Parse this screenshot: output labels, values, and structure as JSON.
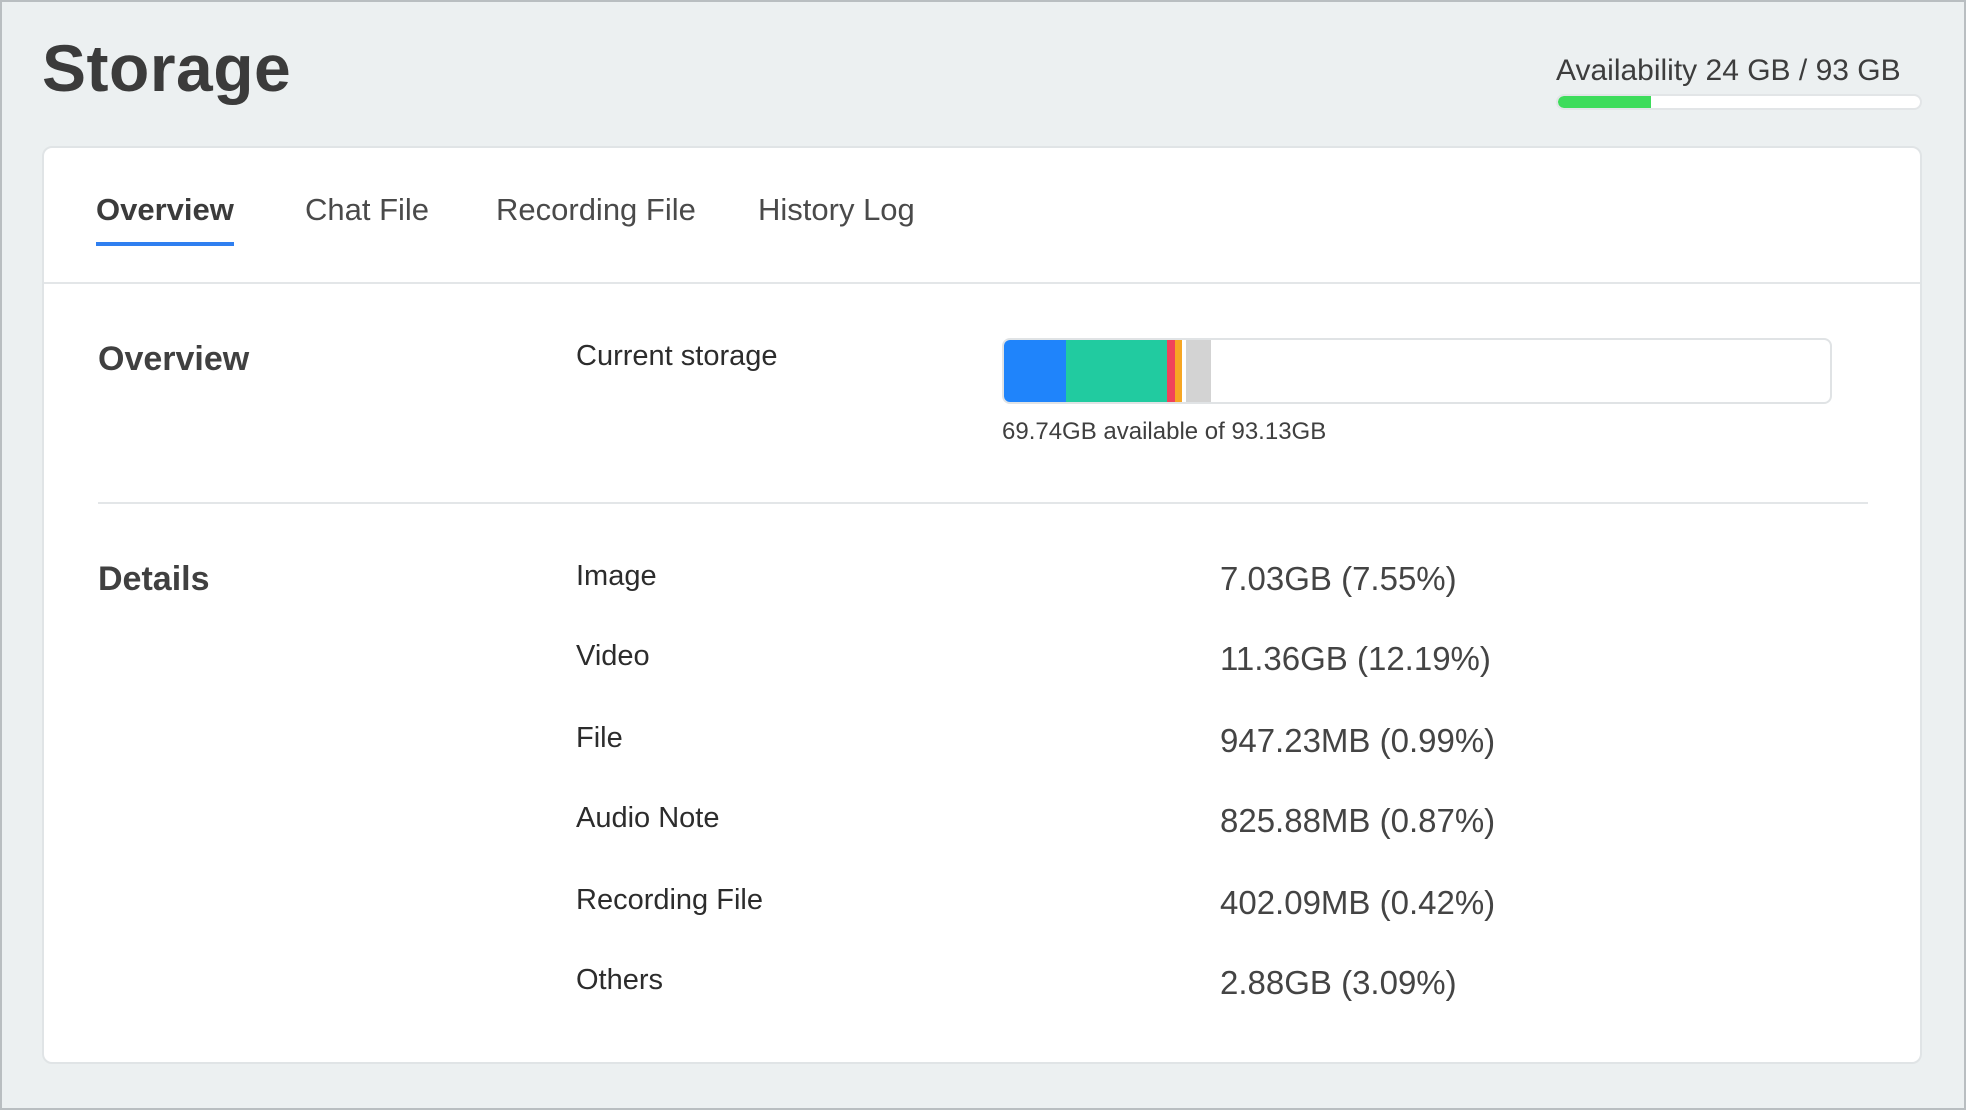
{
  "page": {
    "title": "Storage",
    "availability": {
      "label": "Availability 24 GB / 93 GB",
      "fraction": 0.258,
      "fill_color": "#3ddc5b"
    }
  },
  "tabs": [
    {
      "label": "Overview",
      "active": true
    },
    {
      "label": "Chat File",
      "active": false
    },
    {
      "label": "Recording File",
      "active": false
    },
    {
      "label": "History Log",
      "active": false
    }
  ],
  "overview": {
    "section_label": "Overview",
    "current_storage_label": "Current storage",
    "caption": "69.74GB available of 93.13GB",
    "segments": [
      {
        "name": "image",
        "percent": 7.55,
        "color": "#1f84fb"
      },
      {
        "name": "video",
        "percent": 12.19,
        "color": "#21cba0"
      },
      {
        "name": "file",
        "percent": 0.99,
        "color": "#f0435a"
      },
      {
        "name": "audio-note",
        "percent": 0.87,
        "color": "#f6a623"
      },
      {
        "name": "recording-file",
        "percent": 0.42,
        "color": "#ffffff"
      },
      {
        "name": "others",
        "percent": 3.09,
        "color": "#d3d3d3"
      }
    ]
  },
  "details": {
    "section_label": "Details",
    "rows": [
      {
        "label": "Image",
        "value": "7.03GB (7.55%)"
      },
      {
        "label": "Video",
        "value": "11.36GB (12.19%)"
      },
      {
        "label": "File",
        "value": "947.23MB (0.99%)"
      },
      {
        "label": "Audio Note",
        "value": "825.88MB (0.87%)"
      },
      {
        "label": "Recording File",
        "value": "402.09MB (0.42%)"
      },
      {
        "label": "Others",
        "value": "2.88GB (3.09%)"
      }
    ]
  }
}
